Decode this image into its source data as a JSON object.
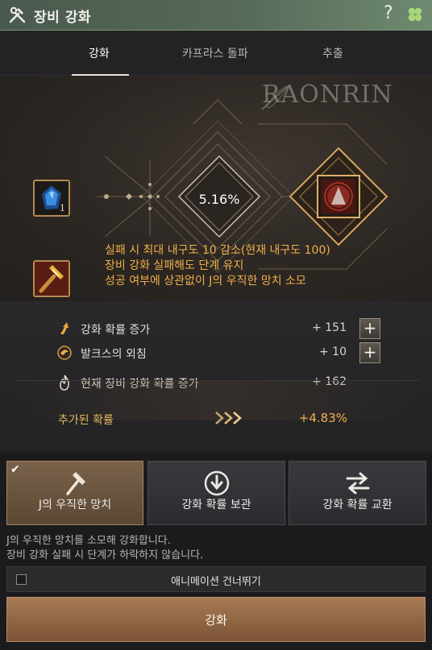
{
  "window": {
    "title": "장비 강화",
    "help_label": "?",
    "icons": [
      "hammer-wrench-icon",
      "clover-icon"
    ]
  },
  "tabs": [
    {
      "label": "강화",
      "active": true
    },
    {
      "label": "카프라스 돌파",
      "active": false
    },
    {
      "label": "추출",
      "active": false
    }
  ],
  "enhance": {
    "watermark": "RAONRIN",
    "chance_percent": "5.16%",
    "material_count": "1",
    "info_lines": [
      "실패 시 최대 내구도 10 감소(현재 내구도 100)",
      "장비 강화 실패해도 단계 유지",
      "성공 여부에 상관없이 J의 우직한 망치 소모"
    ]
  },
  "stats": {
    "rows": [
      {
        "label": "강화 확률 증가",
        "value": "+ 151",
        "icon": "arrow-up-icon",
        "has_plus": true,
        "plus_label": "+"
      },
      {
        "label": "발크스의 외침",
        "value": "+ 10",
        "icon": "valks-cry-icon",
        "has_plus": true,
        "plus_label": "+"
      },
      {
        "label": "현재 장비 강화 확률 증가",
        "value": "+ 162",
        "icon": "flame-icon",
        "has_plus": false
      }
    ],
    "added_label": "추가된 확률",
    "added_value": "+4.83%"
  },
  "options": [
    {
      "label": "J의 우직한 망치",
      "icon": "hammer-icon",
      "selected": true,
      "check": "✔"
    },
    {
      "label": "강화 확률 보관",
      "icon": "download-circle-icon",
      "selected": false
    },
    {
      "label": "강화 확률 교환",
      "icon": "swap-arrows-icon",
      "selected": false
    }
  ],
  "note_lines": [
    "J의 우직한 망치를 소모해 강화합니다.",
    "장비 강화 실패 시 단계가 하락하지 않습니다."
  ],
  "skip_animation": {
    "label": "애니메이션 건너뛰기",
    "checked": false
  },
  "enhance_button": {
    "label": "강화"
  },
  "colors": {
    "accent_orange": "#f0b04a",
    "title_bar_green": "#56695a",
    "enhance_button": "#a87a55"
  }
}
